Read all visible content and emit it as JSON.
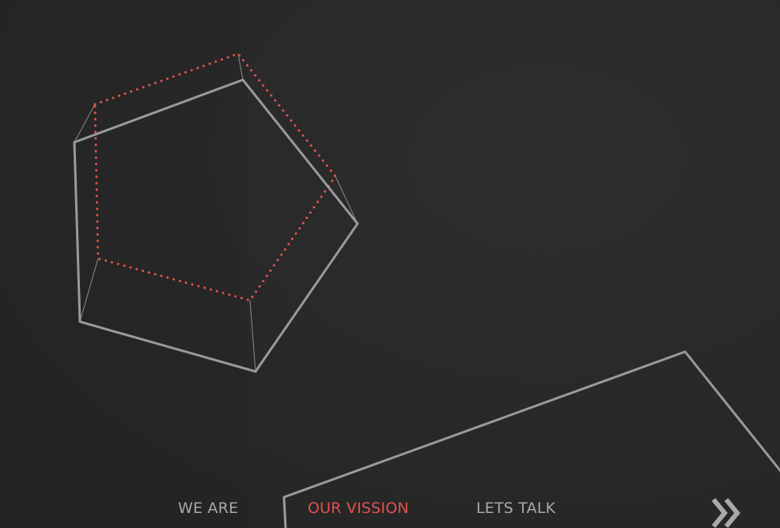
{
  "nav": {
    "items": [
      {
        "label": "WE ARE",
        "active": false
      },
      {
        "label": "OUR VISSION",
        "active": true
      },
      {
        "label": "LETS TALK",
        "active": false
      }
    ],
    "next_icon": "double-chevron-right-icon"
  },
  "colors": {
    "background": "#2a2a2a",
    "outline": "#9a9a9a",
    "accent": "#e2524e",
    "nav_text": "#a9a9a9"
  }
}
